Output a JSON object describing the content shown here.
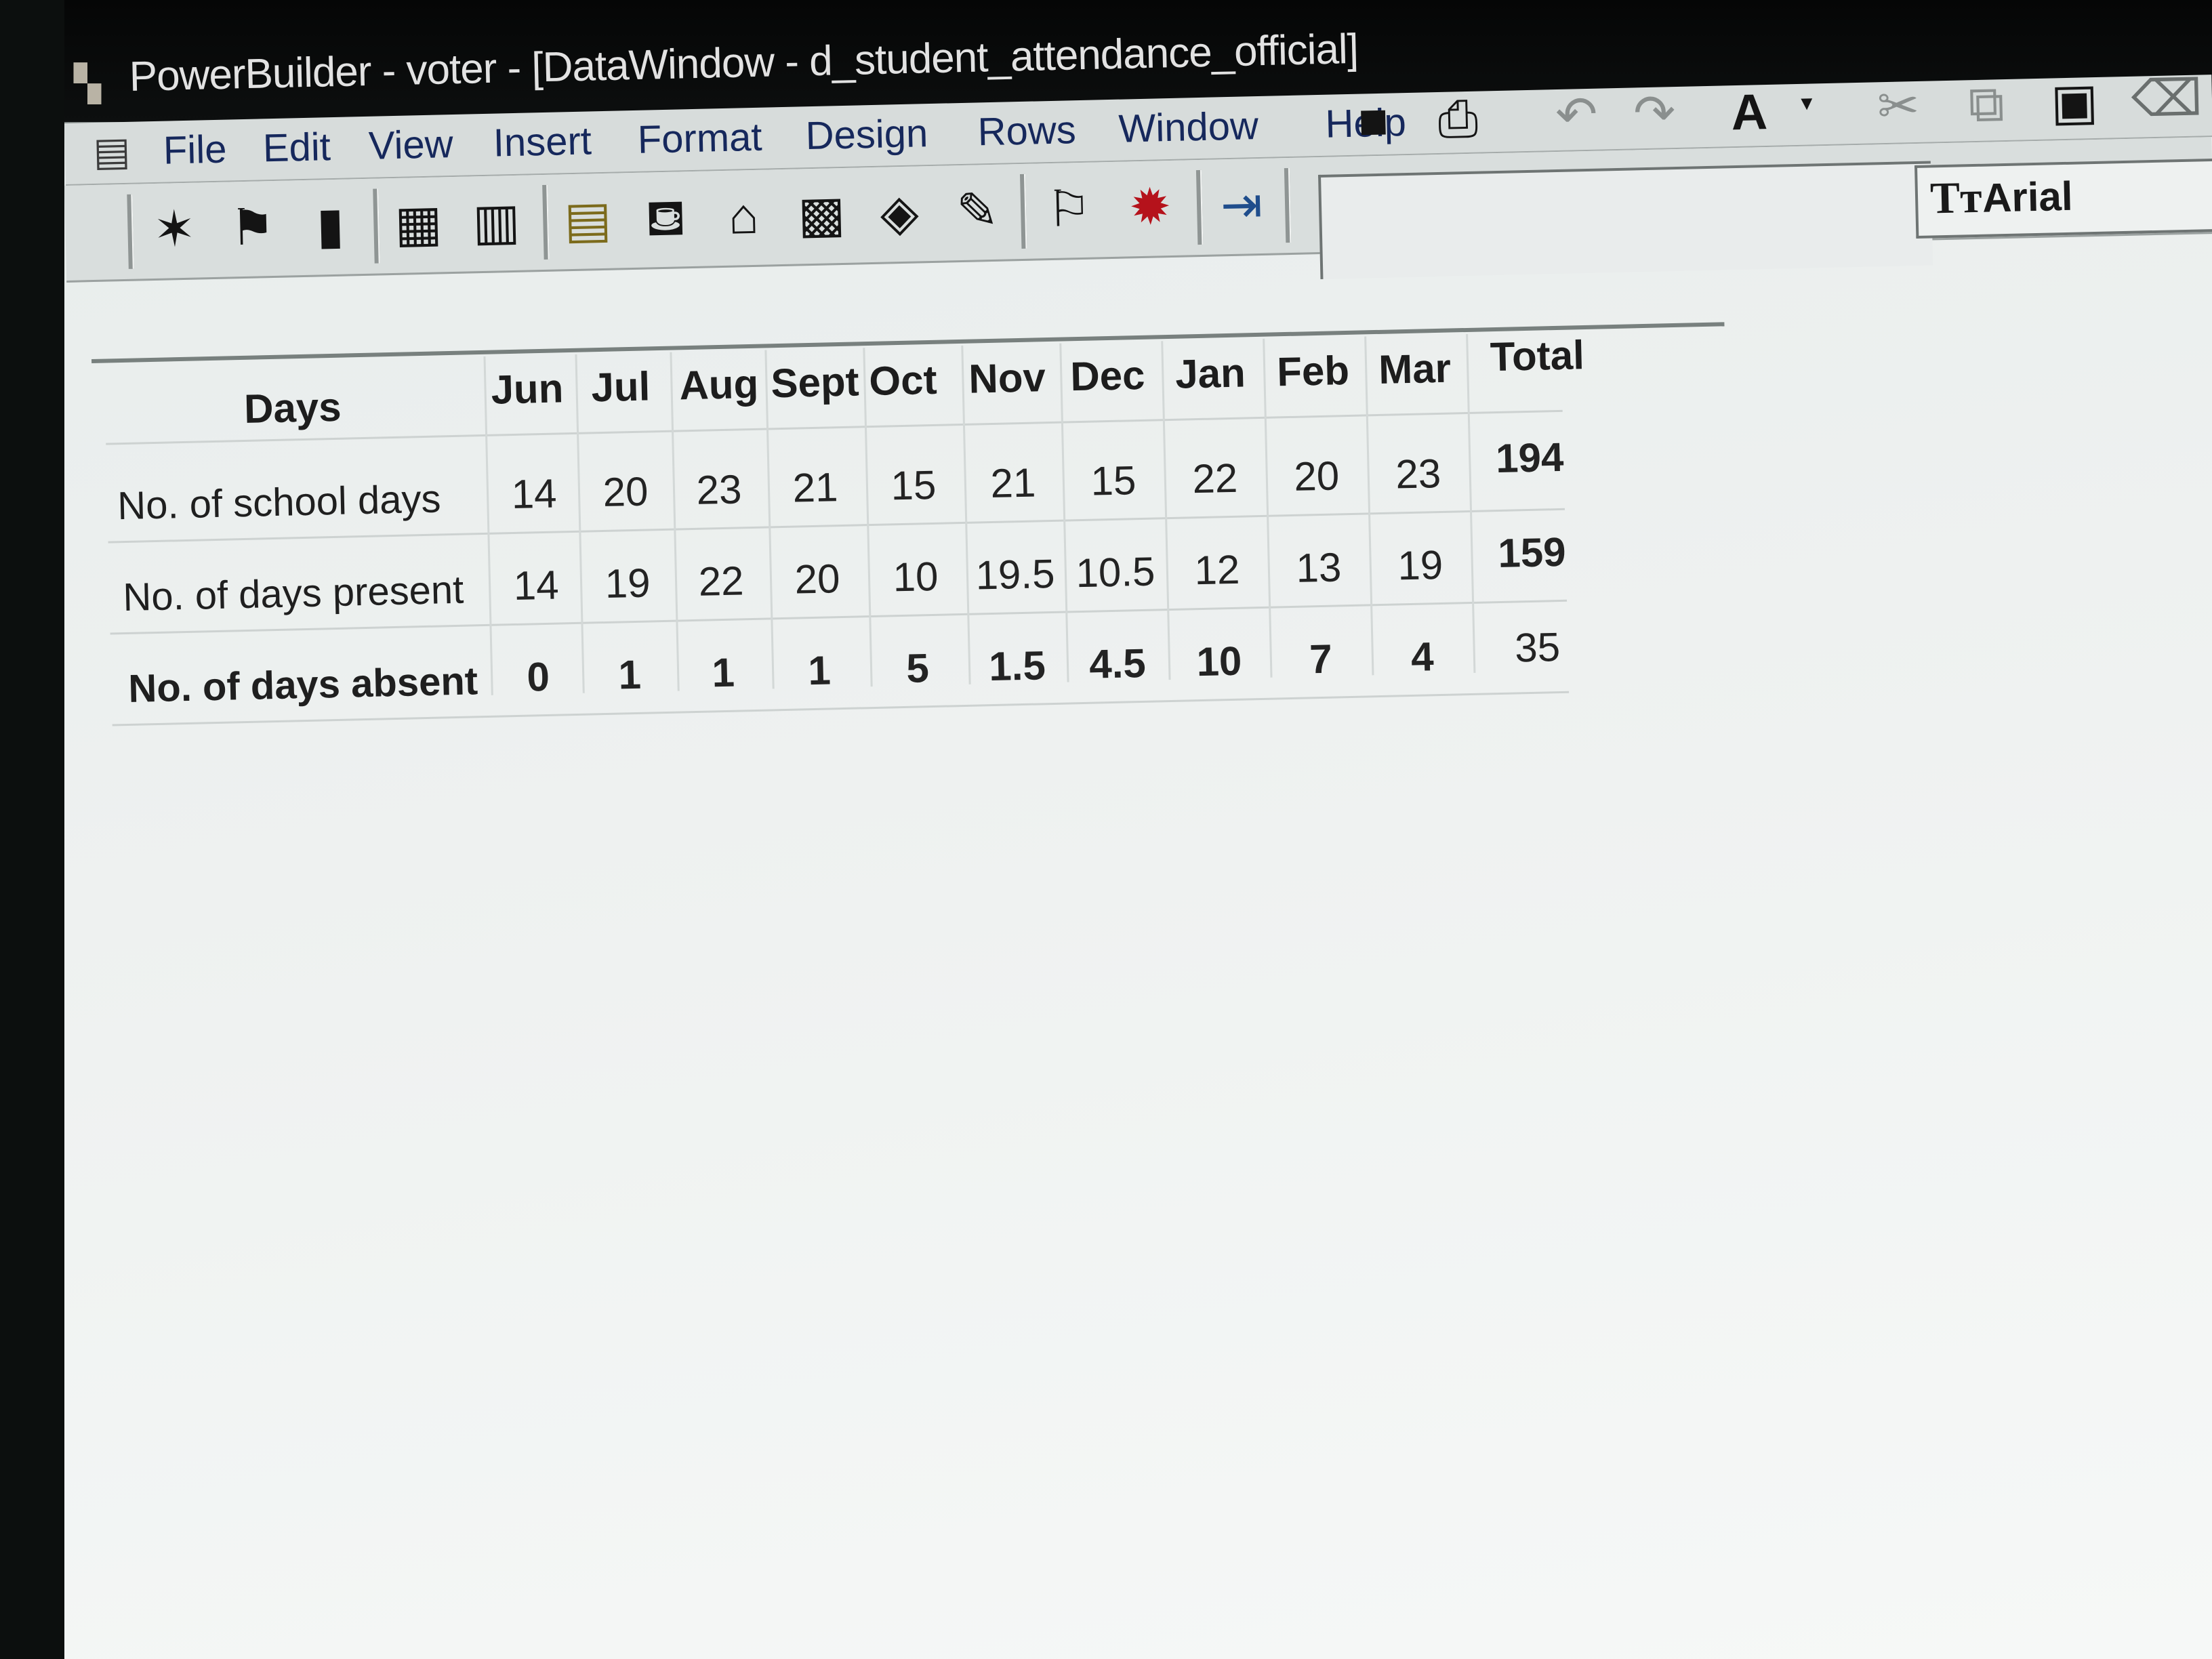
{
  "window": {
    "app_icon": "powerbuilder-icon",
    "title": "PowerBuilder - voter - [DataWindow - d_student_attendance_official]"
  },
  "menu": {
    "doc_icon": "document-icon",
    "items": [
      "File",
      "Edit",
      "View",
      "Insert",
      "Format",
      "Design",
      "Rows",
      "Window",
      "Help"
    ]
  },
  "toolbar": {
    "font_name": "Arial",
    "font_glyph": "Tт"
  },
  "attendance": {
    "header_label": "Days",
    "months": [
      "Jun",
      "Jul",
      "Aug",
      "Sept",
      "Oct",
      "Nov",
      "Dec",
      "Jan",
      "Feb",
      "Mar"
    ],
    "total_label": "Total",
    "rows": [
      {
        "label": "No. of school days",
        "values": [
          "14",
          "20",
          "23",
          "21",
          "15",
          "21",
          "15",
          "22",
          "20",
          "23"
        ],
        "total": "194"
      },
      {
        "label": "No. of days present",
        "values": [
          "14",
          "19",
          "22",
          "20",
          "10",
          "19.5",
          "10.5",
          "12",
          "13",
          "19"
        ],
        "total": "159"
      },
      {
        "label": "No. of days absent",
        "values": [
          "0",
          "1",
          "1",
          "1",
          "5",
          "1.5",
          "4.5",
          "10",
          "7",
          "4"
        ],
        "total": "35"
      }
    ]
  }
}
